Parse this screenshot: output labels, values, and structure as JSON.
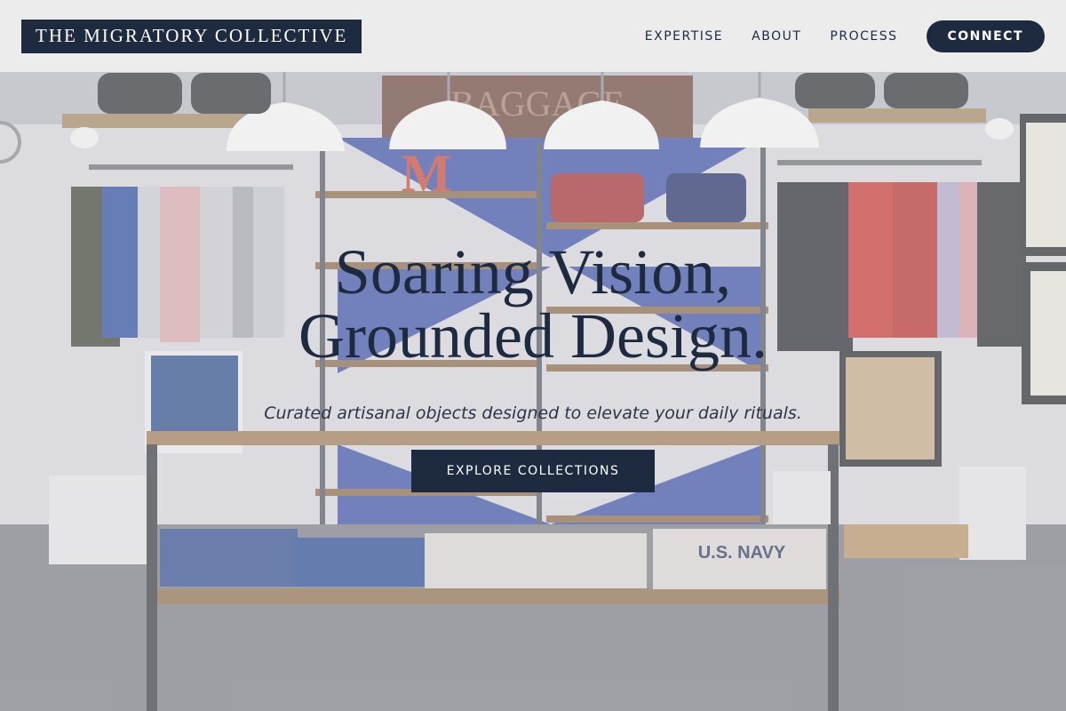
{
  "brand": {
    "name": "THE MIGRATORY COLLECTIVE"
  },
  "nav": {
    "items": [
      {
        "label": "EXPERTISE"
      },
      {
        "label": "ABOUT"
      },
      {
        "label": "PROCESS"
      }
    ],
    "cta_label": "CONNECT"
  },
  "hero": {
    "title_line1": "Soaring Vision,",
    "title_line2": "Grounded Design.",
    "subtitle": "Curated artisanal objects designed to elevate your daily rituals.",
    "cta_label": "EXPLORE COLLECTIONS",
    "background_image": "clothing-store-interior",
    "scene_sign_text": "BAGGAGE",
    "scene_letter": "M",
    "scene_shirt_text": "U.S. NAVY"
  },
  "colors": {
    "navy": "#1e2a40",
    "header_bg": "#eeeeee",
    "white": "#ffffff"
  }
}
